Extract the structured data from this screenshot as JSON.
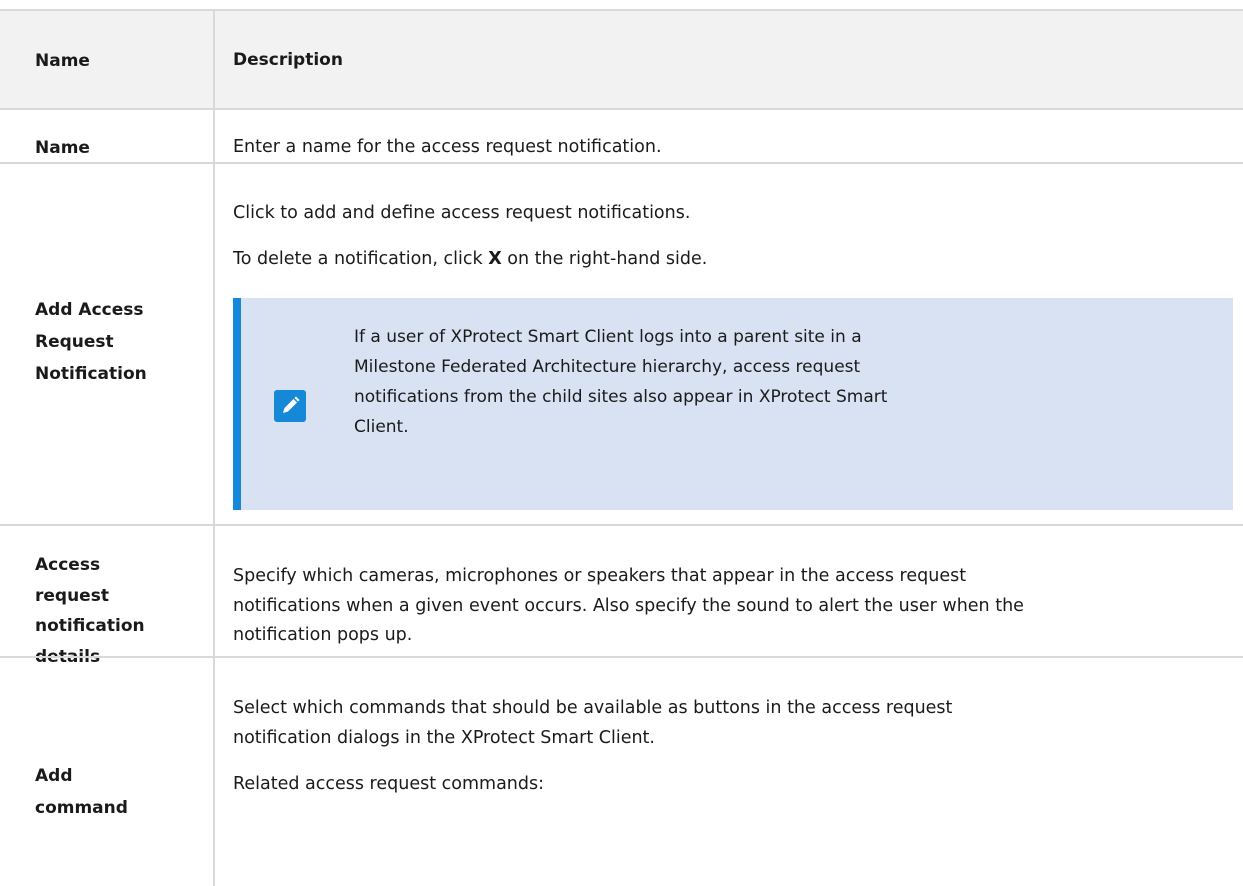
{
  "table": {
    "headers": {
      "name": "Name",
      "description": "Description"
    },
    "rows": [
      {
        "name": "Name",
        "description": [
          "Enter a name for the access request notification."
        ]
      },
      {
        "name_lines": [
          "Add Access",
          "Request",
          "Notification"
        ],
        "description": [
          "Click to add and define access request notifications.",
          "To delete a notification, click",
          "X",
          "on the right-hand side."
        ],
        "note": [
          "If a user of XProtect Smart Client logs into a parent site in a",
          "Milestone Federated Architecture hierarchy, access request",
          "notifications from the child sites also appear in XProtect Smart",
          "Client."
        ],
        "note_icon": "pencil-note-icon"
      },
      {
        "name_lines": [
          "Access",
          "request",
          "notification",
          "details"
        ],
        "description": [
          "Specify which cameras, microphones or speakers that appear in the access request",
          "notifications when a given event occurs. Also specify the sound to alert the user when the",
          "notification pops up."
        ]
      },
      {
        "name_lines": [
          "Add",
          "command"
        ],
        "description": [
          "Select which commands that should be available as buttons in the access request",
          "notification dialogs in the XProtect Smart Client.",
          "Related access request commands:"
        ]
      }
    ]
  },
  "colors": {
    "header_bg": "#f2f2f2",
    "grid": "#d9d9d9",
    "note_bg": "#d8e2f2",
    "note_accent": "#1688d8"
  }
}
